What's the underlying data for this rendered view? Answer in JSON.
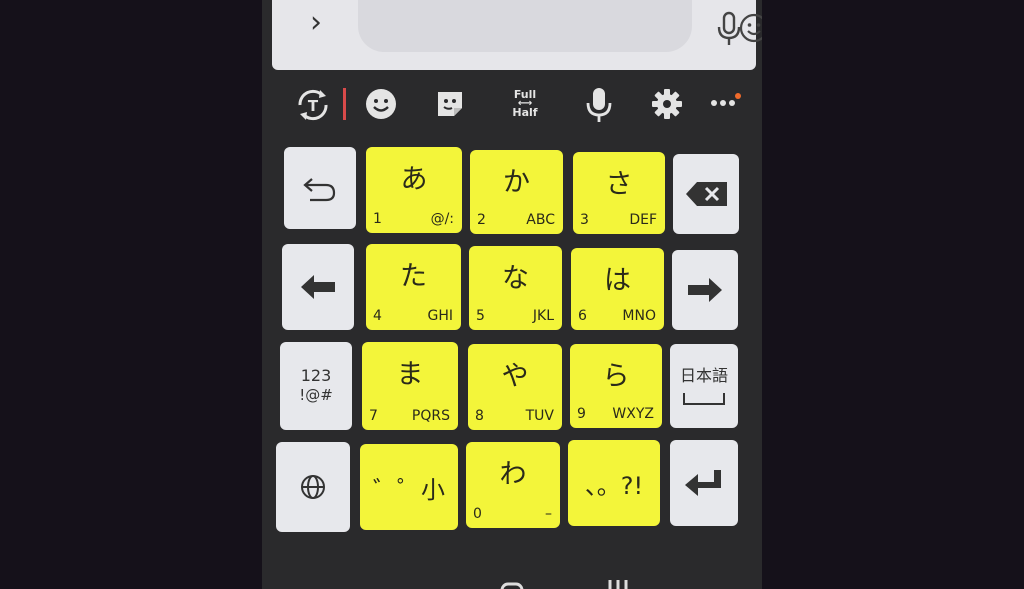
{
  "toolbar": {
    "full_label": "Full",
    "half_label": "Half",
    "arrow_glyph": "⟷"
  },
  "keys": {
    "row1": [
      {
        "kana": "あ",
        "num": "1",
        "sub": "@/:"
      },
      {
        "kana": "か",
        "num": "2",
        "sub": "ABC"
      },
      {
        "kana": "さ",
        "num": "3",
        "sub": "DEF"
      }
    ],
    "row2": [
      {
        "kana": "た",
        "num": "4",
        "sub": "GHI"
      },
      {
        "kana": "な",
        "num": "5",
        "sub": "JKL"
      },
      {
        "kana": "は",
        "num": "6",
        "sub": "MNO"
      }
    ],
    "row3": [
      {
        "kana": "ま",
        "num": "7",
        "sub": "PQRS"
      },
      {
        "kana": "や",
        "num": "8",
        "sub": "TUV"
      },
      {
        "kana": "ら",
        "num": "9",
        "sub": "WXYZ"
      }
    ],
    "row4": [
      {
        "label": "゛゜小"
      },
      {
        "kana": "わ",
        "num": "0",
        "sub": "–"
      },
      {
        "label": "、。?!"
      }
    ],
    "symbols_line1": "123",
    "symbols_line2": "!@#",
    "lang_label": "日本語"
  },
  "colors": {
    "kana_key": "#f3f53a",
    "side_key": "#e7e8ec",
    "background": "#2a2a2c",
    "notification_dot": "#f06a2b"
  }
}
